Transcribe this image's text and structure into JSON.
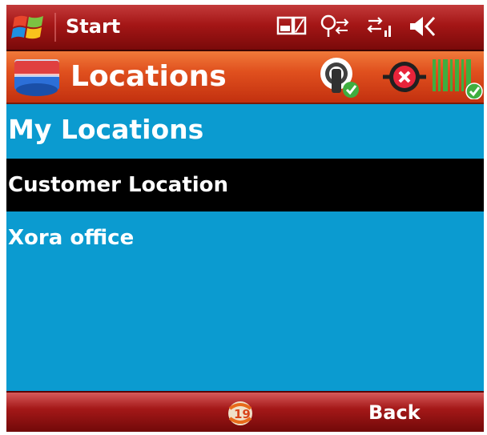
{
  "status_bar": {
    "start_label": "Start",
    "icons": [
      "battery-status-icon",
      "signal-icon",
      "connectivity-icon",
      "volume-icon"
    ]
  },
  "title_bar": {
    "title": "Locations",
    "icons": [
      "gps-icon",
      "error-status-icon",
      "barcode-status-icon"
    ]
  },
  "list": {
    "heading": "My Locations",
    "items": [
      {
        "label": "Customer Location",
        "selected": true
      },
      {
        "label": "Xora office",
        "selected": false
      }
    ]
  },
  "softkeys": {
    "center_icon": "sync-icon",
    "right_label": "Back"
  },
  "colors": {
    "background": "#0b9bd0",
    "selection": "#000000",
    "status_bar": "#a41616",
    "title_bar": "#e0501e"
  }
}
